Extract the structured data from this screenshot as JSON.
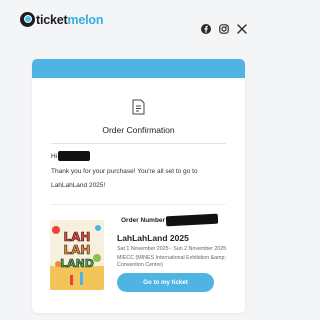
{
  "brand": {
    "name_part1": "ticket",
    "name_part2": "melon"
  },
  "socials": [
    "facebook-icon",
    "instagram-icon",
    "x-icon"
  ],
  "email": {
    "title": "Order Confirmation",
    "greeting_prefix": "Hi",
    "message": "Thank you for your purchase! You're all set to go to LahLahLand 2025!"
  },
  "event": {
    "poster_text": [
      "LAH",
      "LAH",
      "LAND"
    ],
    "order_label": "Order Number",
    "name": "LahLahLand 2025",
    "dates": "Sat 1 November 2025 - Sun 2 November 2025",
    "venue": "MIECC (MINES International Exhibition &amp; Convention Centre)",
    "cta_label": "Go to my ticket"
  },
  "colors": {
    "accent": "#4fb3e3",
    "background": "#f4f5f7"
  }
}
